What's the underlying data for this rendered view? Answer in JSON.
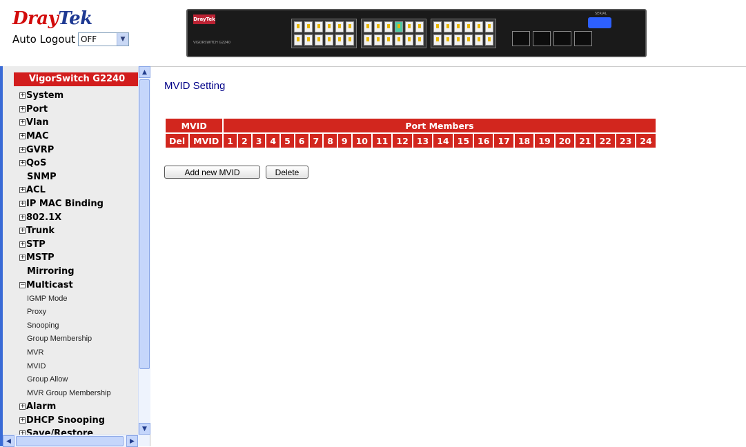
{
  "header": {
    "brand_first": "Dray",
    "brand_second": "Tek",
    "auto_logout_label": "Auto Logout",
    "auto_logout_value": "OFF",
    "device_logo": "DrayTek",
    "device_model": "VIGORSWITCH G2240",
    "serial_label": "SERIAL"
  },
  "sidebar": {
    "title": "VigorSwitch G2240",
    "items": [
      {
        "label": "System",
        "expand": "+"
      },
      {
        "label": "Port",
        "expand": "+"
      },
      {
        "label": "Vlan",
        "expand": "+"
      },
      {
        "label": "MAC",
        "expand": "+"
      },
      {
        "label": "GVRP",
        "expand": "+"
      },
      {
        "label": "QoS",
        "expand": "+"
      },
      {
        "label": "SNMP",
        "expand": ""
      },
      {
        "label": "ACL",
        "expand": "+"
      },
      {
        "label": "IP MAC Binding",
        "expand": "+"
      },
      {
        "label": "802.1X",
        "expand": "+"
      },
      {
        "label": "Trunk",
        "expand": "+"
      },
      {
        "label": "STP",
        "expand": "+"
      },
      {
        "label": "MSTP",
        "expand": "+"
      },
      {
        "label": "Mirroring",
        "expand": ""
      },
      {
        "label": "Multicast",
        "expand": "−"
      }
    ],
    "multicast_sub": [
      "IGMP Mode",
      "Proxy",
      "Snooping",
      "Group Membership",
      "MVR",
      "MVID",
      "Group Allow",
      "MVR Group Membership"
    ],
    "items_after": [
      {
        "label": "Alarm",
        "expand": "+"
      },
      {
        "label": "DHCP Snooping",
        "expand": "+"
      },
      {
        "label": "Save/Restore",
        "expand": "+"
      }
    ]
  },
  "main": {
    "title": "MVID Setting",
    "table": {
      "group_header_mvid": "MVID",
      "group_header_ports": "Port Members",
      "col_del": "Del",
      "col_mvid": "MVID",
      "ports": [
        "1",
        "2",
        "3",
        "4",
        "5",
        "6",
        "7",
        "8",
        "9",
        "10",
        "11",
        "12",
        "13",
        "14",
        "15",
        "16",
        "17",
        "18",
        "19",
        "20",
        "21",
        "22",
        "23",
        "24"
      ]
    },
    "add_button": "Add new MVID",
    "delete_button": "Delete"
  }
}
